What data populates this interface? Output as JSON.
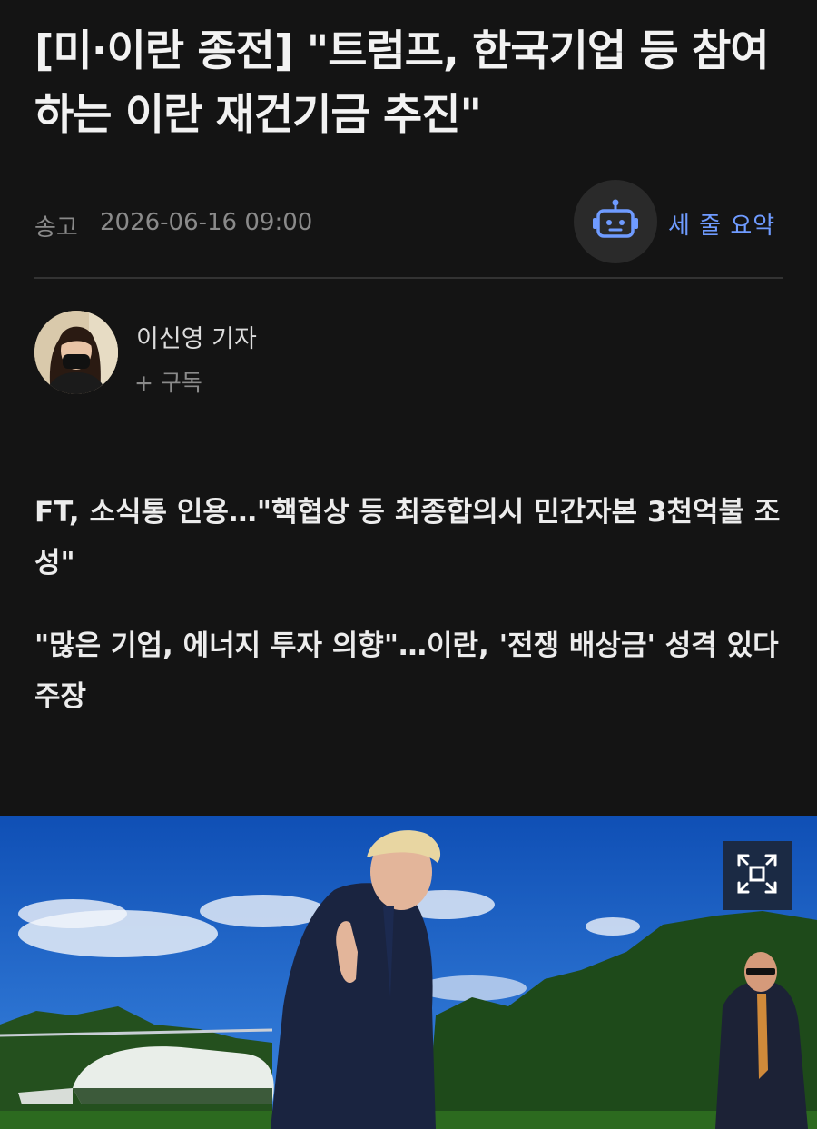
{
  "article": {
    "headline": "[미·이란 종전] \"트럼프, 한국기업 등 참여하는 이란 재건기금 추진\"",
    "meta": {
      "label": "송고",
      "date": "2026-06-16 09:00"
    },
    "summary": {
      "icon": "robot-icon",
      "label": "세 줄 요약"
    },
    "reporter": {
      "name": "이신영 기자",
      "subscribe": "+ 구독"
    },
    "sub_headlines": [
      "FT, 소식통 인용…\"핵협상 등 최종합의시 민간자본 3천억불 조성\"",
      "\"많은 기업, 에너지 투자 의향\"…이란, '전쟁 배상금' 성격 있다 주장"
    ],
    "photo": {
      "expand_icon": "expand-icon"
    }
  },
  "colors": {
    "background": "#141414",
    "accent": "#6f9bff",
    "muted": "#8a8a8a"
  }
}
